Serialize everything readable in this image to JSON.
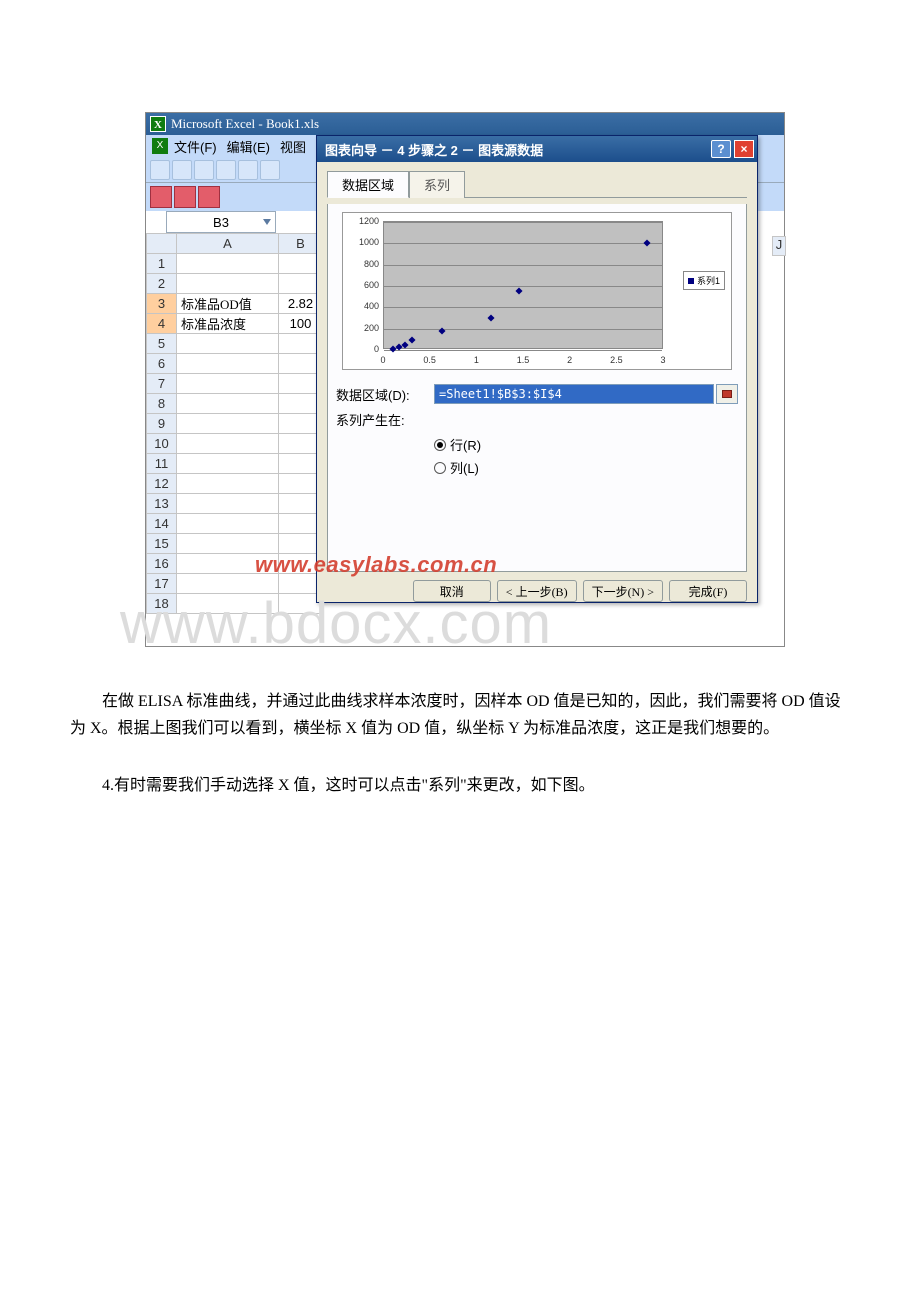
{
  "excel": {
    "title": "Microsoft Excel - Book1.xls",
    "menus": {
      "file": "文件(F)",
      "edit": "编辑(E)",
      "view": "视图"
    },
    "namebox": "B3",
    "colA": "A",
    "colB": "B",
    "colJ": "J",
    "rows": [
      "1",
      "2",
      "3",
      "4",
      "5",
      "6",
      "7",
      "8",
      "9",
      "10",
      "11",
      "12",
      "13",
      "14",
      "15",
      "16",
      "17",
      "18"
    ],
    "r3a": "标准品OD值",
    "r3b": "2.82",
    "r4a": "标准品浓度",
    "r4b": "100"
  },
  "dialog": {
    "title": "图表向导 － 4 步骤之 2 － 图表源数据",
    "help": "?",
    "close": "×",
    "tab_data": "数据区域",
    "tab_series": "系列",
    "range_label": "数据区域(D):",
    "range_value": "=Sheet1!$B$3:$I$4",
    "series_in": "系列产生在:",
    "opt_row": "行(R)",
    "opt_col": "列(L)",
    "btn_cancel": "取消",
    "btn_back": "< 上一步(B)",
    "btn_next": "下一步(N) >",
    "btn_finish": "完成(F)",
    "legend": "系列1"
  },
  "chart_data": {
    "type": "scatter",
    "series": [
      {
        "name": "系列1",
        "x": [
          0.1,
          0.16,
          0.22,
          0.3,
          0.62,
          1.15,
          1.45,
          2.82
        ],
        "y": [
          10,
          30,
          50,
          90,
          180,
          300,
          550,
          1000
        ]
      }
    ],
    "xticks": [
      0,
      0.5,
      1,
      1.5,
      2,
      2.5,
      3
    ],
    "yticks": [
      0,
      200,
      400,
      600,
      800,
      1000,
      1200
    ],
    "xlim": [
      0,
      3
    ],
    "ylim": [
      0,
      1200
    ],
    "xlabel": "",
    "ylabel": ""
  },
  "watermarks": {
    "easylabs": "www.easylabs.com.cn",
    "bdocx": "www.bdocx.com"
  },
  "text": {
    "p1": "　　在做 ELISA 标准曲线，并通过此曲线求样本浓度时，因样本 OD 值是已知的，因此，我们需要将 OD 值设为 X。根据上图我们可以看到，横坐标 X 值为 OD 值，纵坐标 Y 为标准品浓度，这正是我们想要的。",
    "p2": "　　4.有时需要我们手动选择 X 值，这时可以点击\"系列\"来更改，如下图。"
  }
}
